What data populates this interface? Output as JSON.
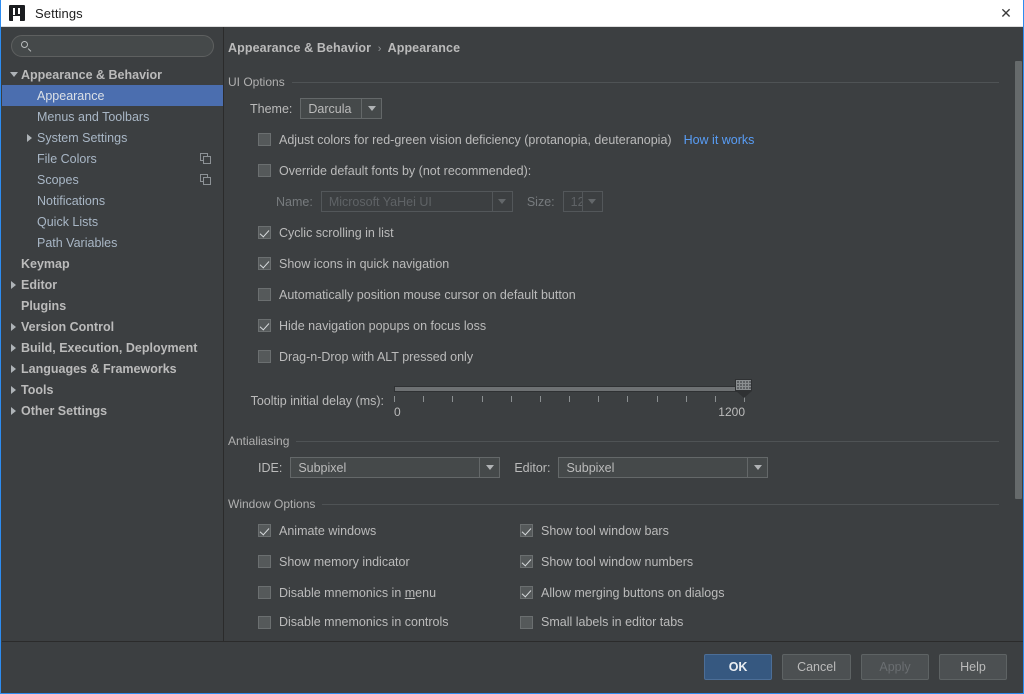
{
  "window": {
    "title": "Settings",
    "app_icon": "intellij-logo-icon",
    "close_label": "✕",
    "accent_border": "#2d8cf0"
  },
  "sidebar": {
    "search": {
      "value": "",
      "placeholder": "",
      "icon": "search-icon"
    },
    "items": [
      {
        "label": "Appearance & Behavior",
        "level": 0,
        "twisty": "down",
        "selected": false,
        "bold": true
      },
      {
        "label": "Appearance",
        "level": 1,
        "twisty": "none",
        "selected": true,
        "bold": false
      },
      {
        "label": "Menus and Toolbars",
        "level": 1,
        "twisty": "none",
        "selected": false,
        "bold": false
      },
      {
        "label": "System Settings",
        "level": 1,
        "twisty": "right",
        "selected": false,
        "bold": false
      },
      {
        "label": "File Colors",
        "level": 1,
        "twisty": "none",
        "selected": false,
        "bold": false,
        "trailing_icon": "copy-icon"
      },
      {
        "label": "Scopes",
        "level": 1,
        "twisty": "none",
        "selected": false,
        "bold": false,
        "trailing_icon": "copy-icon"
      },
      {
        "label": "Notifications",
        "level": 1,
        "twisty": "none",
        "selected": false,
        "bold": false
      },
      {
        "label": "Quick Lists",
        "level": 1,
        "twisty": "none",
        "selected": false,
        "bold": false
      },
      {
        "label": "Path Variables",
        "level": 1,
        "twisty": "none",
        "selected": false,
        "bold": false
      },
      {
        "label": "Keymap",
        "level": 0,
        "twisty": "none",
        "selected": false,
        "bold": true
      },
      {
        "label": "Editor",
        "level": 0,
        "twisty": "right",
        "selected": false,
        "bold": true
      },
      {
        "label": "Plugins",
        "level": 0,
        "twisty": "none",
        "selected": false,
        "bold": true
      },
      {
        "label": "Version Control",
        "level": 0,
        "twisty": "right",
        "selected": false,
        "bold": true
      },
      {
        "label": "Build, Execution, Deployment",
        "level": 0,
        "twisty": "right",
        "selected": false,
        "bold": true
      },
      {
        "label": "Languages & Frameworks",
        "level": 0,
        "twisty": "right",
        "selected": false,
        "bold": true
      },
      {
        "label": "Tools",
        "level": 0,
        "twisty": "right",
        "selected": false,
        "bold": true
      },
      {
        "label": "Other Settings",
        "level": 0,
        "twisty": "right",
        "selected": false,
        "bold": true
      }
    ]
  },
  "breadcrumb": {
    "root": "Appearance & Behavior",
    "separator": "›",
    "current": "Appearance"
  },
  "ui_options": {
    "title": "UI Options",
    "theme_label": "Theme:",
    "theme_value": "Darcula",
    "adjust_colors": {
      "label": "Adjust colors for red-green vision deficiency (protanopia, deuteranopia)",
      "checked": false,
      "link": "How it works"
    },
    "override_fonts": {
      "label": "Override default fonts by (not recommended):",
      "checked": false
    },
    "font_name_label": "Name:",
    "font_name_value": "Microsoft YaHei UI",
    "font_size_label": "Size:",
    "font_size_value": "12",
    "checkboxes": [
      {
        "label": "Cyclic scrolling in list",
        "checked": true
      },
      {
        "label": "Show icons in quick navigation",
        "checked": true
      },
      {
        "label": "Automatically position mouse cursor on default button",
        "checked": false
      },
      {
        "label": "Hide navigation popups on focus loss",
        "checked": true
      },
      {
        "label": "Drag-n-Drop with ALT pressed only",
        "checked": false
      }
    ],
    "tooltip_slider": {
      "label": "Tooltip initial delay (ms):",
      "min": 0,
      "max": 1200,
      "value": 1200,
      "min_label": "0",
      "max_label": "1200",
      "tick_count": 13
    }
  },
  "antialiasing": {
    "title": "Antialiasing",
    "ide_label": "IDE:",
    "ide_value": "Subpixel",
    "editor_label": "Editor:",
    "editor_value": "Subpixel"
  },
  "window_options": {
    "title": "Window Options",
    "left_column": [
      {
        "label": "Animate windows",
        "checked": true
      },
      {
        "label": "Show memory indicator",
        "checked": false
      },
      {
        "label": "Disable mnemonics in menu",
        "checked": false,
        "mnemonic": "m"
      },
      {
        "label": "Disable mnemonics in controls",
        "checked": false,
        "clipped": true
      }
    ],
    "right_column": [
      {
        "label": "Show tool window bars",
        "checked": true
      },
      {
        "label": "Show tool window numbers",
        "checked": true
      },
      {
        "label": "Allow merging buttons on dialogs",
        "checked": true
      },
      {
        "label": "Small labels in editor tabs",
        "checked": false,
        "clipped": true
      }
    ]
  },
  "footer": {
    "ok": "OK",
    "cancel": "Cancel",
    "apply": "Apply",
    "help": "Help",
    "apply_disabled": true
  }
}
